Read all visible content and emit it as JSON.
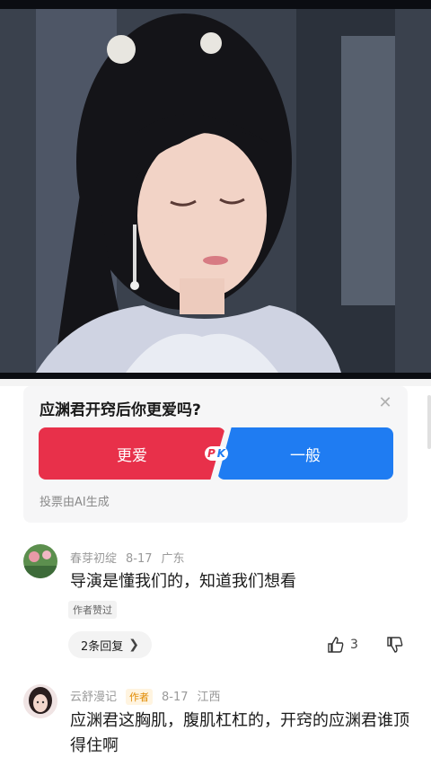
{
  "poll": {
    "question": "应渊君开窍后你更爱吗?",
    "option_more": "更爱",
    "option_normal": "一般",
    "pk_left": "P",
    "pk_right": "K",
    "note": "投票由AI生成"
  },
  "comments": [
    {
      "user": "春芽初绽",
      "date": "8-17",
      "region": "广东",
      "text": "导演是懂我们的，知道我们想看",
      "badge": "作者赞过",
      "replies_label": "2条回复",
      "likes": "3"
    },
    {
      "user": "云舒漫记",
      "author_tag": "作者",
      "date": "8-17",
      "region": "江西",
      "text": "应渊君这胸肌，腹肌杠杠的，开窍的应渊君谁顶得住啊"
    }
  ],
  "colors": {
    "more": "#e8304a",
    "normal": "#1f7cf2"
  }
}
